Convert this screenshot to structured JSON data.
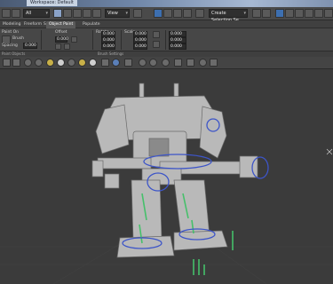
{
  "window": {
    "title_tab": "Workspace: Default"
  },
  "toolbar": {
    "selection_filter": "All",
    "ref_coord": "View",
    "named_selection": "Create Selection Se",
    "colors": {
      "accent": "#3d6fb0",
      "active": "#8aa2c8"
    }
  },
  "tabs": [
    "Modeling",
    "Freeform",
    "Selection",
    "Object Paint",
    "Populate"
  ],
  "tabs_active_index": 3,
  "ribbon": {
    "brush_label": "Paint On",
    "brush_field_label": "Brush",
    "spacing_label": "Spacing",
    "spacing_value": "0.000",
    "offset_label": "Offset",
    "offset_value": "0.000",
    "scale_label": "Scale",
    "rotate_label": "Rotate",
    "value_x": "0.000",
    "value_y": "0.000",
    "value_z": "0.000",
    "value_x2": "0.000",
    "value_y2": "0.000",
    "value_z2": "0.000",
    "group1": "Paint Objects",
    "group2": "Brush Settings"
  },
  "subtoolbar": {
    "icons": [
      "select-icon",
      "undo-icon",
      "redo-icon",
      "lock-icon",
      "snap-icon",
      "light-icon",
      "camera-icon",
      "render-icon",
      "sphere-icon",
      "box-icon",
      "material-icon",
      "grid-icon"
    ]
  },
  "viewport": {
    "label": "[+] [Perspective] [Realistic]",
    "colors": {
      "bg": "#3b3b3b",
      "model": "#b9b9b9",
      "gizmo": "#3d55c8",
      "bone": "#45c06a"
    }
  }
}
